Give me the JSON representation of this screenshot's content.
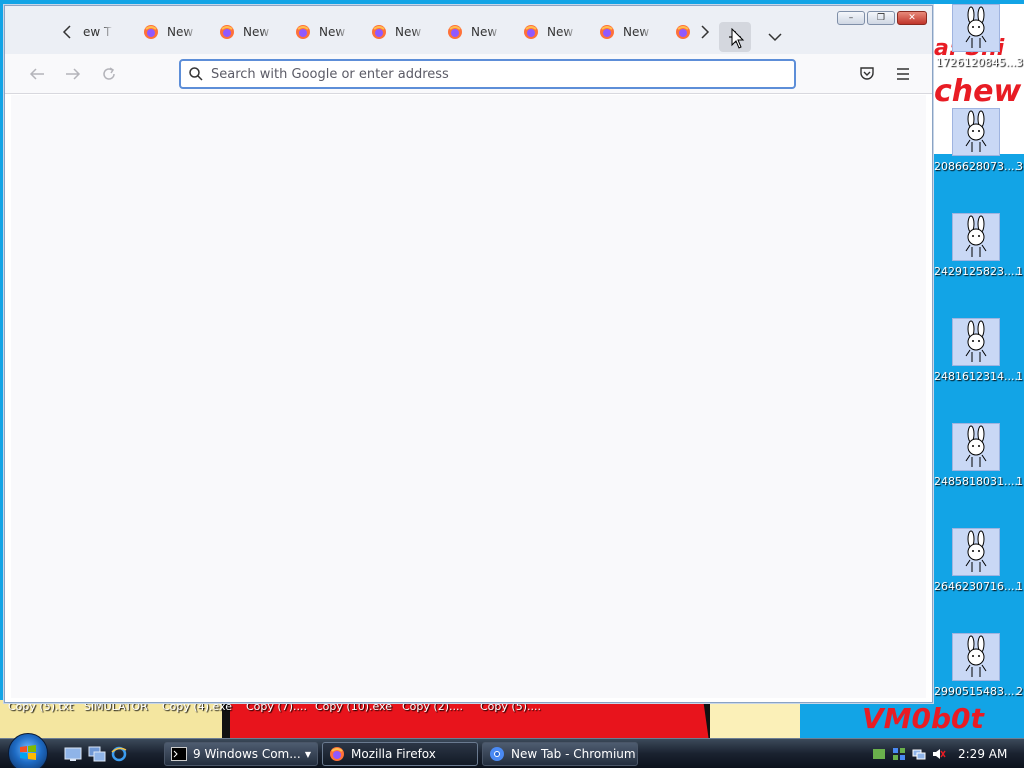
{
  "window": {
    "title": "Mozilla Firefox",
    "tabs": [
      {
        "label": "ew T"
      },
      {
        "label": "New T"
      },
      {
        "label": "New T"
      },
      {
        "label": "New T"
      },
      {
        "label": "New T"
      },
      {
        "label": "New T"
      },
      {
        "label": "New T"
      },
      {
        "label": "New T"
      },
      {
        "label": ""
      }
    ],
    "controls": {
      "minimize": "–",
      "restore": "❐",
      "close": "✕"
    }
  },
  "navbar": {
    "back": "←",
    "forward": "→",
    "reload": "↻",
    "url_placeholder": "Search with Google or enter address",
    "url_value": ""
  },
  "desktop": {
    "bg_text_top": "a: Shi",
    "bg_text_chew": "chew",
    "bg_text_vm": "VM0b0t",
    "icons": [
      {
        "label": "1726120845..."
      },
      {
        "label": "2086628073...."
      },
      {
        "label": "2429125823...."
      },
      {
        "label": "2481612314...."
      },
      {
        "label": "2485818031...."
      },
      {
        "label": "2646230716...."
      },
      {
        "label": "2990515483...."
      }
    ],
    "edge_labels": [
      "3",
      "3",
      "1",
      "1",
      "1",
      "1",
      "2"
    ],
    "bottom_files": [
      "Copy (5).txt",
      "SIMULATOR",
      "Copy (4).exe",
      "Copy (7)....",
      "Copy (10).exe",
      "Copy (2)....",
      "Copy (5)...."
    ]
  },
  "taskbar": {
    "tasks": [
      {
        "label": "9 Windows Com..."
      },
      {
        "label": "Mozilla Firefox"
      },
      {
        "label": "New Tab - Chromium"
      }
    ],
    "clock": "2:29 AM"
  },
  "colors": {
    "accent": "#5d8ed8",
    "desktop_bg": "#12a4e6",
    "content_bg": "#f9f9fb"
  }
}
